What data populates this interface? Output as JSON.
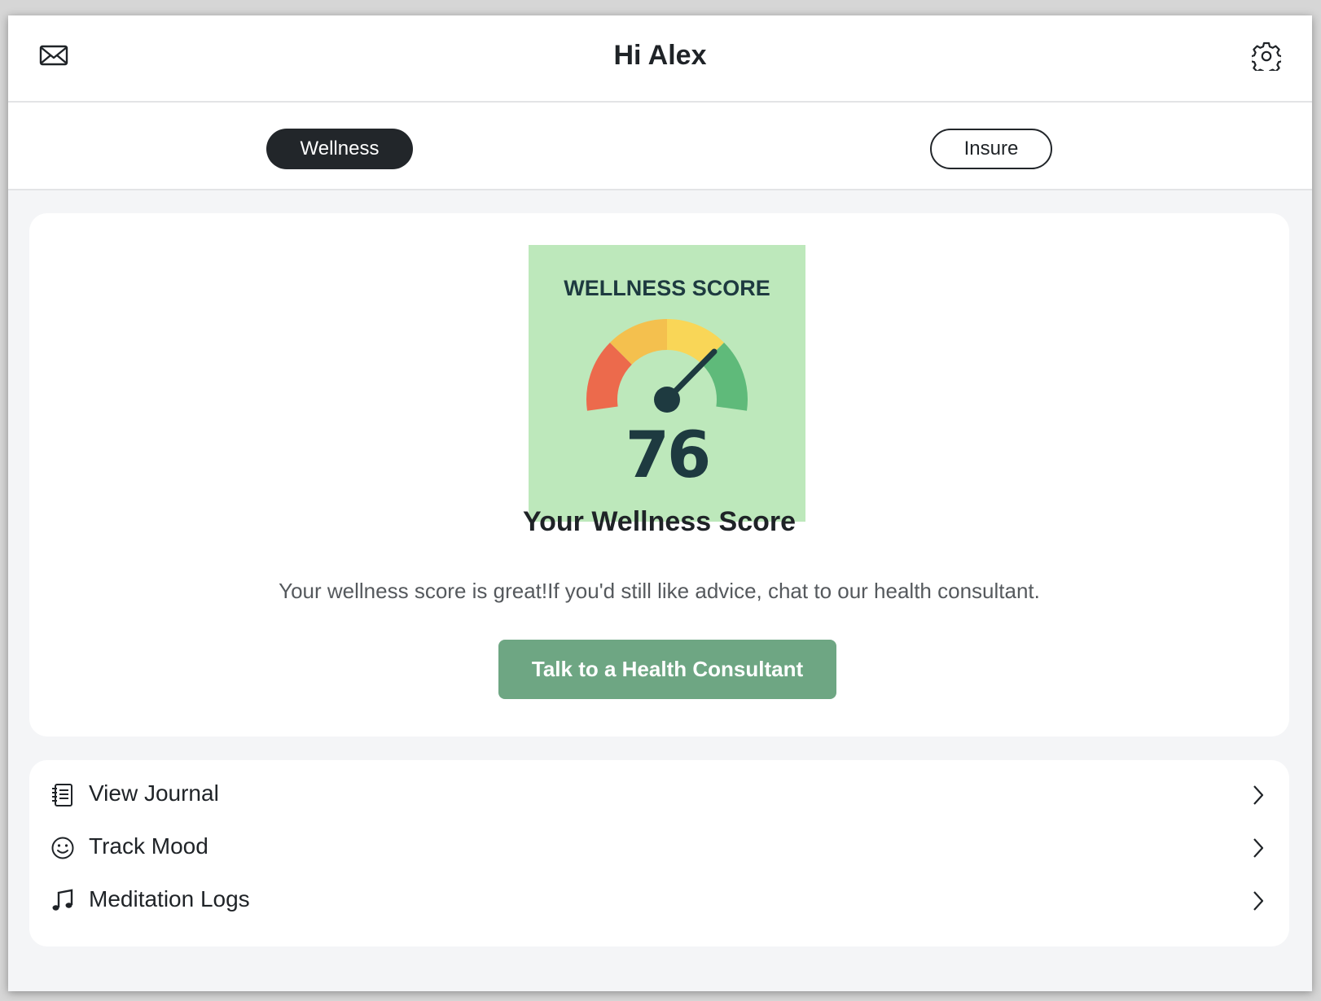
{
  "header": {
    "greeting": "Hi Alex",
    "left_icon": "mail-icon",
    "right_icon": "gear-icon"
  },
  "tabs": [
    {
      "label": "Wellness",
      "active": true
    },
    {
      "label": "Insure",
      "active": false
    }
  ],
  "score_card": {
    "image": {
      "heading": "WELLNESS SCORE",
      "score": "76",
      "background": "#bde8bb",
      "gauge_colors": [
        "#ec6a4c",
        "#f4c04e",
        "#f9d657",
        "#5fba7a"
      ]
    },
    "title": "Your Wellness Score",
    "description": "Your wellness score is great!If you'd still like advice, chat to our health consultant.",
    "cta_label": "Talk to a Health Consultant",
    "cta_color": "#6ea683"
  },
  "menu": {
    "items": [
      {
        "label": "View Journal",
        "icon": "journal-icon"
      },
      {
        "label": "Track Mood",
        "icon": "smiley-icon"
      },
      {
        "label": "Meditation Logs",
        "icon": "music-note-icon"
      }
    ]
  }
}
